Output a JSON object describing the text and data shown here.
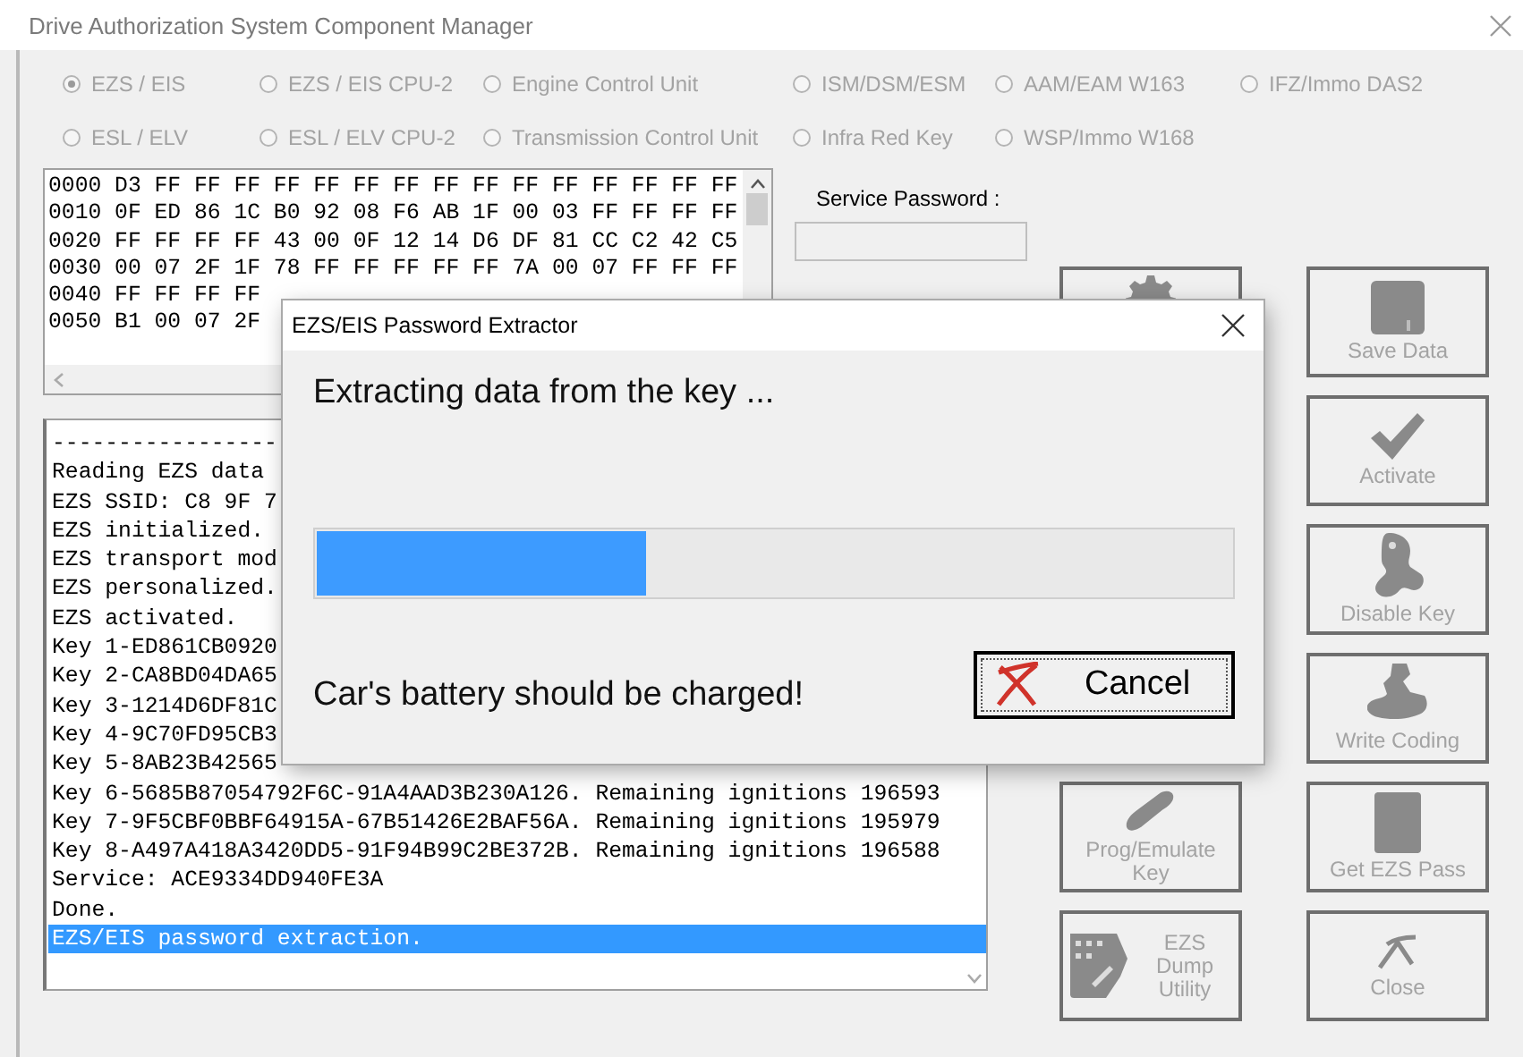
{
  "window": {
    "title": "Drive Authorization System Component Manager"
  },
  "radios": [
    {
      "label": "EZS / EIS",
      "selected": true,
      "disabled": true
    },
    {
      "label": "EZS / EIS CPU-2",
      "selected": false,
      "disabled": true
    },
    {
      "label": "Engine Control Unit",
      "selected": false,
      "disabled": true
    },
    {
      "label": "ISM/DSM/ESM",
      "selected": false,
      "disabled": true
    },
    {
      "label": "AAM/EAM W163",
      "selected": false,
      "disabled": true
    },
    {
      "label": "IFZ/Immo DAS2",
      "selected": false,
      "disabled": true
    },
    {
      "label": "ESL / ELV",
      "selected": false,
      "disabled": true
    },
    {
      "label": "ESL / ELV CPU-2",
      "selected": false,
      "disabled": true
    },
    {
      "label": "Transmission Control Unit",
      "selected": false,
      "disabled": true
    },
    {
      "label": "Infra Red Key",
      "selected": false,
      "disabled": true
    },
    {
      "label": "WSP/Immo W168",
      "selected": false,
      "disabled": true
    }
  ],
  "hex_view": {
    "lines": [
      "0000 D3 FF FF FF FF FF FF FF FF FF FF FF FF FF FF FF",
      "0010 0F ED 86 1C B0 92 08 F6 AB 1F 00 03 FF FF FF FF",
      "0020 FF FF FF FF 43 00 0F 12 14 D6 DF 81 CC C2 42 C5",
      "0030 00 07 2F 1F 78 FF FF FF FF FF 7A 00 07 FF FF FF",
      "0040 FF FF FF FF",
      "0050 B1 00 07 2F"
    ]
  },
  "service_password": {
    "label": "Service Password :",
    "disabled": true
  },
  "log": {
    "lines": [
      {
        "text": "-----------------",
        "selected": false
      },
      {
        "text": "Reading EZS data",
        "selected": false
      },
      {
        "text": "EZS SSID: C8 9F 7",
        "selected": false
      },
      {
        "text": "EZS initialized.",
        "selected": false
      },
      {
        "text": "EZS transport mod",
        "selected": false
      },
      {
        "text": "EZS personalized.",
        "selected": false
      },
      {
        "text": "EZS activated.",
        "selected": false
      },
      {
        "text": "Key 1-ED861CB0920",
        "selected": false
      },
      {
        "text": "Key 2-CA8BD04DA65",
        "selected": false
      },
      {
        "text": "Key 3-1214D6DF81C",
        "selected": false
      },
      {
        "text": "Key 4-9C70FD95CB3",
        "selected": false
      },
      {
        "text": "Key 5-8AB23B42565",
        "selected": false
      },
      {
        "text": "Key 6-5685B87054792F6C-91A4AAD3B230A126. Remaining ignitions 196593",
        "selected": false
      },
      {
        "text": "Key 7-9F5CBF0BBF64915A-67B51426E2BAF56A. Remaining ignitions 195979",
        "selected": false
      },
      {
        "text": "Key 8-A497A418A3420DD5-91F94B99C2BE372B. Remaining ignitions 196588",
        "selected": false
      },
      {
        "text": "Service: ACE9334DD940FE3A",
        "selected": false
      },
      {
        "text": "Done.",
        "selected": false
      },
      {
        "text": "EZS/EIS password extraction.",
        "selected": true
      }
    ]
  },
  "buttons_left": [
    {
      "kind": "gear",
      "disabled": true
    },
    {
      "kind": "key-fob",
      "label": "Prog/Emulate Key",
      "disabled": true
    },
    {
      "kind": "dump",
      "label": "EZS Dump Utility",
      "disabled": true
    }
  ],
  "buttons_right": [
    {
      "kind": "save",
      "label": "Save Data",
      "disabled": true
    },
    {
      "kind": "check",
      "label": "Activate",
      "disabled": true
    },
    {
      "kind": "key",
      "label": "Disable Key",
      "disabled": true
    },
    {
      "kind": "stamp",
      "label": "Write Coding",
      "disabled": true
    },
    {
      "kind": "card",
      "label": "Get EZS Pass",
      "disabled": true
    },
    {
      "kind": "close",
      "label": "Close",
      "disabled": true
    }
  ],
  "dialog": {
    "title": "EZS/EIS Password Extractor",
    "message": "Extracting data from the key ...",
    "progress": {
      "level": 0.36
    },
    "warning": "Car's battery should be charged!",
    "cancel_button": {
      "label": "Cancel"
    }
  }
}
